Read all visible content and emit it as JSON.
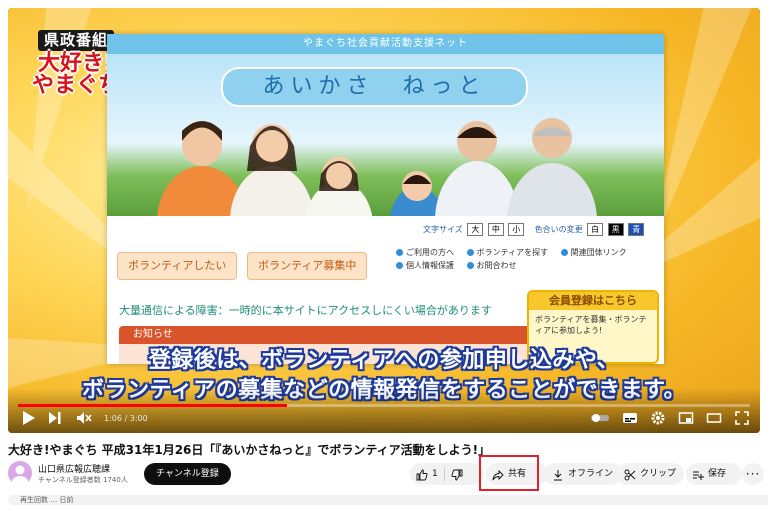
{
  "video": {
    "show_logo": {
      "line1": "県政番組",
      "line2": "大好き!",
      "line3": "やまぐち"
    },
    "site": {
      "top_bar": "やまぐち社会貢献活動支援ネット",
      "logo_text": "あいかさ　ねっと",
      "text_size_label": "文字サイズ",
      "text_size_options": [
        "大",
        "中",
        "小"
      ],
      "color_label": "色合いの変更",
      "color_options": [
        "白",
        "黒",
        "青"
      ],
      "tab_volunteer": "ボランティアしたい",
      "tab_recruit": "ボランティア募集中",
      "links": [
        [
          "ご利用の方へ",
          "ボランティアを探す",
          "関連団体リンク"
        ],
        [
          "個人情報保護",
          "お問合わせ"
        ]
      ],
      "notice": "大量通信による障害：一時的に本サイトにアクセスしにくい場合があります",
      "info_header": "お知らせ",
      "member_title": "会員登録はこちら",
      "member_body": "ボランティアを募集・ボランティアに参加しよう!"
    },
    "caption_line1": "登録後は、ボランティアへの参加申し込みや、",
    "caption_line2": "ボランティアの募集などの情報発信をすることができます。",
    "time_display": "1:06 / 3:00",
    "progress": 0.367
  },
  "title": "大好き!やまぐち 平成31年1月26日「『あいかさねっと』でボランティア活動をしよう!」",
  "channel": {
    "name": "山口県広報広聴課",
    "subscribers": "チャンネル登録者数 1740人",
    "subscribe_label": "チャンネル登録"
  },
  "actions": {
    "like_count": "1",
    "share_label": "共有",
    "offline_label": "オフライン",
    "clip_label": "クリップ",
    "save_label": "保存"
  },
  "description_preview": "再生回数 … 日前",
  "colors": {
    "accent_red": "#e0202b",
    "progress_red": "#ff0000",
    "caption_outline": "#1d3a9c"
  }
}
